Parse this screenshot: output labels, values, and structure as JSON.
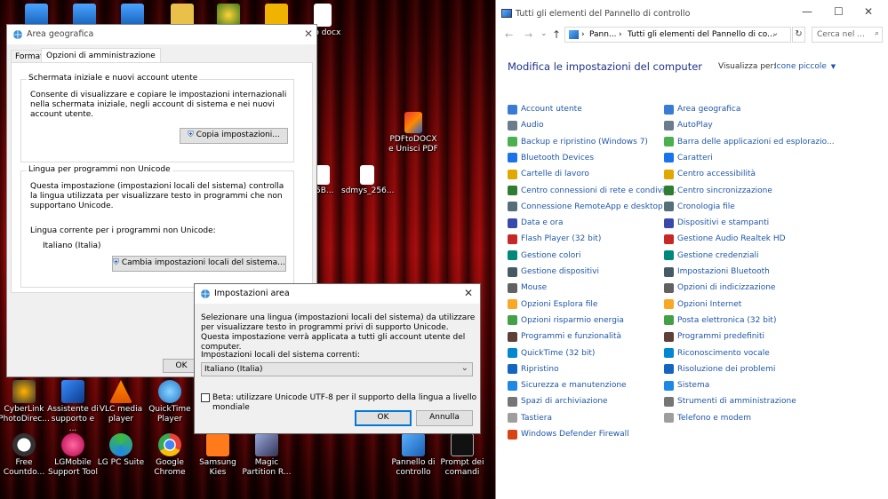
{
  "desktop": {
    "top_icons": [
      "",
      "",
      "",
      "",
      "",
      "",
      "sito docx"
    ],
    "mid_icons": [
      {
        "label": "PDFtoDOCX e Unisci PDF"
      },
      {
        "label": "_5B..."
      },
      {
        "label": "sdmys_256..."
      }
    ],
    "row1": [
      {
        "label": "CyberLink PhotoDirec..."
      },
      {
        "label": "Assistente di supporto e ..."
      },
      {
        "label": "VLC media player"
      },
      {
        "label": "QuickTime Player"
      }
    ],
    "row2": [
      {
        "label": "Free Countdo..."
      },
      {
        "label": "LGMobile Support Tool"
      },
      {
        "label": "LG PC Suite"
      },
      {
        "label": "Google Chrome"
      },
      {
        "label": "Samsung Kies"
      },
      {
        "label": "Magic Partition R..."
      },
      {
        "label": "Pannello di controllo"
      },
      {
        "label": "Prompt dei comandi"
      }
    ]
  },
  "area_window": {
    "title": "Area geografica",
    "tabs": [
      "Formati",
      "Opzioni di amministrazione"
    ],
    "group1": {
      "title": "Schermata iniziale e nuovi account utente",
      "text": "Consente di visualizzare e copiare le impostazioni internazionali nella schermata iniziale, negli account di sistema e nei nuovi account utente.",
      "button": "Copia impostazioni..."
    },
    "group2": {
      "title": "Lingua per programmi non Unicode",
      "text": "Questa impostazione (impostazioni locali del sistema) controlla la lingua utilizzata per visualizzare testo in programmi che non supportano Unicode.",
      "current_label": "Lingua corrente per i programmi non Unicode:",
      "current_value": "Italiano (Italia)",
      "button": "Cambia impostazioni locali del sistema..."
    },
    "ok_button": "OK"
  },
  "dialog": {
    "title": "Impostazioni area",
    "text": "Selezionare una lingua (impostazioni locali del sistema) da utilizzare per visualizzare testo in programmi privi di supporto Unicode. Questa impostazione verrà applicata a tutti gli account utente del computer.",
    "select_label": "Impostazioni locali del sistema correnti:",
    "select_value": "Italiano (Italia)",
    "checkbox_label": "Beta: utilizzare Unicode UTF-8 per il supporto della lingua a livello mondiale",
    "ok": "OK",
    "cancel": "Annulla"
  },
  "control_panel": {
    "title": "Tutti gli elementi del Pannello di controllo",
    "breadcrumb": [
      "Pann...",
      "Tutti gli elementi del Pannello di co..."
    ],
    "search_placeholder": "Cerca nel ...",
    "heading": "Modifica le impostazioni del computer",
    "view_label": "Visualizza per:",
    "view_value": "Icone piccole",
    "left_items": [
      "Account utente",
      "Audio",
      "Backup e ripristino (Windows 7)",
      "Bluetooth Devices",
      "Cartelle di lavoro",
      "Centro connessioni di rete e condivis...",
      "Connessione RemoteApp e desktop",
      "Data e ora",
      "Flash Player (32 bit)",
      "Gestione colori",
      "Gestione dispositivi",
      "Mouse",
      "Opzioni Esplora file",
      "Opzioni risparmio energia",
      "Programmi e funzionalità",
      "QuickTime (32 bit)",
      "Ripristino",
      "Sicurezza e manutenzione",
      "Spazi di archiviazione",
      "Tastiera",
      "Windows Defender Firewall"
    ],
    "right_items": [
      "Area geografica",
      "AutoPlay",
      "Barra delle applicazioni ed esplorazio...",
      "Caratteri",
      "Centro accessibilità",
      "Centro sincronizzazione",
      "Cronologia file",
      "Dispositivi e stampanti",
      "Gestione Audio Realtek HD",
      "Gestione credenziali",
      "Impostazioni Bluetooth",
      "Opzioni di indicizzazione",
      "Opzioni Internet",
      "Posta elettronica (32 bit)",
      "Programmi predefiniti",
      "Riconoscimento vocale",
      "Risoluzione dei problemi",
      "Sistema",
      "Strumenti di amministrazione",
      "Telefono e modem"
    ]
  },
  "colors": {
    "accent": "#0078d7",
    "cp_heading": "#1e3287",
    "link": "#1e56a8"
  }
}
